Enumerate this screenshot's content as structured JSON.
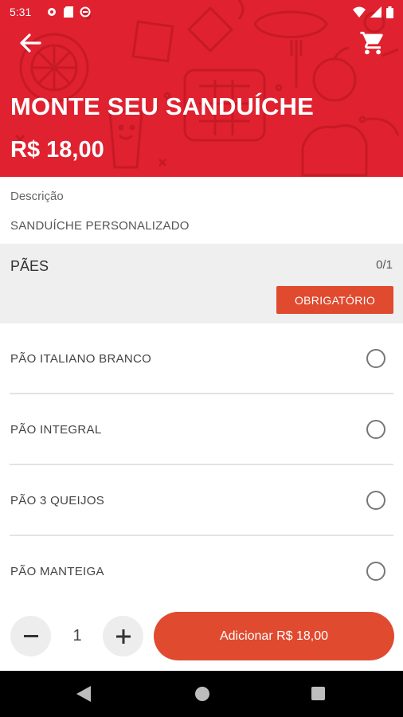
{
  "status": {
    "time": "5:31",
    "left_icons": [
      "settings-icon",
      "sim-icon",
      "sync-icon"
    ],
    "right_icons": [
      "wifi-icon",
      "signal-icon",
      "battery-icon"
    ]
  },
  "colors": {
    "header": "#e0212f",
    "accent": "#e04a2f",
    "group_bg": "#efefef"
  },
  "header": {
    "back_icon": "arrow-left-icon",
    "cart_icon": "shopping-cart-icon",
    "title": "MONTE SEU SANDUÍCHE",
    "price": "R$ 18,00"
  },
  "description": {
    "label": "Descrição",
    "value": "SANDUÍCHE PERSONALIZADO"
  },
  "group": {
    "title": "PÃES",
    "count": "0/1",
    "required_label": "OBRIGATÓRIO",
    "options": [
      {
        "label": "PÃO ITALIANO BRANCO",
        "selected": false
      },
      {
        "label": "PÃO INTEGRAL",
        "selected": false
      },
      {
        "label": "PÃO 3 QUEIJOS",
        "selected": false
      },
      {
        "label": "PÃO MANTEIGA",
        "selected": false
      }
    ]
  },
  "footer": {
    "quantity": "1",
    "minus_icon": "minus-icon",
    "plus_icon": "plus-icon",
    "add_label": "Adicionar R$ 18,00"
  },
  "navbar": {
    "icons": [
      "nav-back-icon",
      "nav-home-icon",
      "nav-recents-icon"
    ]
  }
}
